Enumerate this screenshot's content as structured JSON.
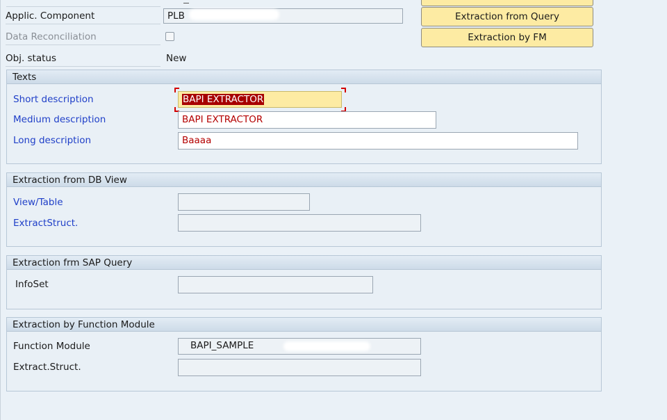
{
  "header": {
    "applic_component": {
      "label": "Applic. Component",
      "value": "PLB"
    },
    "data_reconciliation": {
      "label": "Data Reconciliation",
      "checked": false
    },
    "obj_status": {
      "label": "Obj. status",
      "value": "New"
    },
    "buttons": {
      "extraction_from_query": "Extraction from Query",
      "extraction_by_fm": "Extraction by FM"
    }
  },
  "texts": {
    "title": "Texts",
    "short_description": {
      "label": "Short description",
      "value": "BAPI EXTRACTOR"
    },
    "medium_description": {
      "label": "Medium description",
      "value": "BAPI EXTRACTOR"
    },
    "long_description": {
      "label": "Long description",
      "value": "Baaaa"
    }
  },
  "db_view": {
    "title": "Extraction from DB View",
    "view_table": {
      "label": "View/Table",
      "value": ""
    },
    "extract_struct": {
      "label": "ExtractStruct.",
      "value": ""
    }
  },
  "sap_query": {
    "title": "Extraction frm SAP Query",
    "infoset": {
      "label": "InfoSet",
      "value": ""
    }
  },
  "function_module": {
    "title": "Extraction by Function Module",
    "function_module": {
      "label": "Function Module",
      "value": "BAPI_SAMPLE"
    },
    "extract_struct": {
      "label": "Extract.Struct.",
      "value": ""
    }
  },
  "colors": {
    "background": "#eaf1f7",
    "button_yellow": "#fdeba3",
    "label_blue": "#1f3fc8",
    "value_red": "#b40000",
    "selection_red": "#a70000"
  }
}
